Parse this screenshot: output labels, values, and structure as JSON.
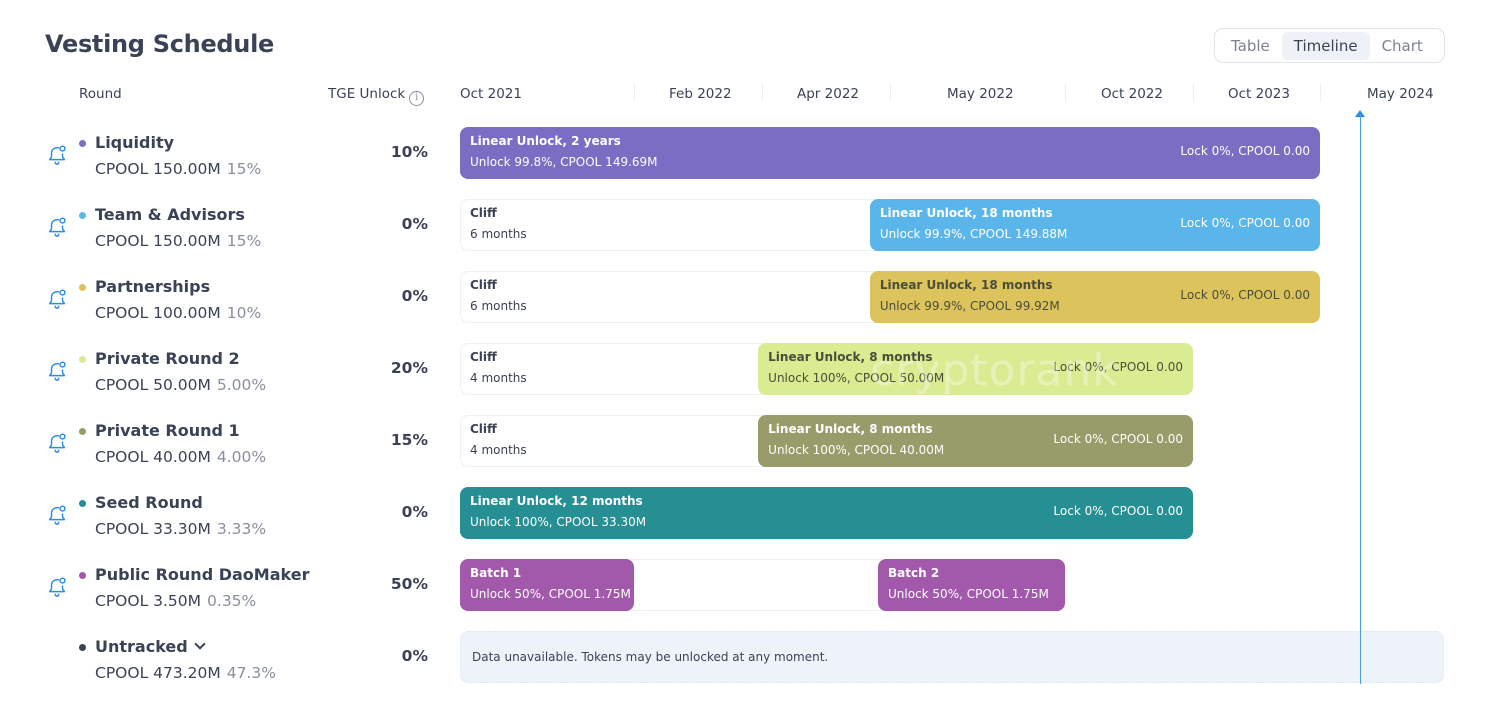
{
  "header": {
    "title": "Vesting Schedule",
    "view_options": [
      {
        "label": "Table",
        "active": false
      },
      {
        "label": "Timeline",
        "active": true
      },
      {
        "label": "Chart",
        "active": false
      }
    ]
  },
  "columns": {
    "round": "Round",
    "tge_unlock": "TGE Unlock",
    "tge_info_icon": "i"
  },
  "timeline": {
    "ticks": [
      "Oct 2021",
      "Feb 2022",
      "Apr 2022",
      "May 2022",
      "Oct 2022",
      "Oct 2023",
      "May 2024"
    ],
    "now_marker": "current-date-marker",
    "watermark": "cryptorank"
  },
  "rounds": [
    {
      "name": "Liquidity",
      "amount": "CPOOL 150.00M",
      "share": "15%",
      "tge": "10%",
      "color": "#7b6cc4",
      "bell": true,
      "segments": [
        {
          "type": "linear",
          "title": "Linear Unlock, 2 years",
          "detail": "Unlock 99.8%, CPOOL 149.69M",
          "lock": "Lock 0%, CPOOL 0.00",
          "color": "#7b6cc4",
          "start": 0,
          "end": 6
        }
      ]
    },
    {
      "name": "Team & Advisors",
      "amount": "CPOOL 150.00M",
      "share": "15%",
      "tge": "0%",
      "color": "#5ab6ea",
      "bell": true,
      "segments": [
        {
          "type": "cliff",
          "title": "Cliff",
          "detail": "6 months",
          "start": 0,
          "end": 2.93
        },
        {
          "type": "linear",
          "title": "Linear Unlock, 18 months",
          "detail": "Unlock 99.9%, CPOOL 149.88M",
          "lock": "Lock 0%, CPOOL 0.00",
          "color": "#5ab6ea",
          "start": 2.93,
          "end": 6
        }
      ]
    },
    {
      "name": "Partnerships",
      "amount": "CPOOL 100.00M",
      "share": "10%",
      "tge": "0%",
      "color": "#dcc35c",
      "bell": true,
      "segments": [
        {
          "type": "cliff",
          "title": "Cliff",
          "detail": "6 months",
          "start": 0,
          "end": 2.93
        },
        {
          "type": "linear",
          "title": "Linear Unlock, 18 months",
          "detail": "Unlock 99.9%, CPOOL 99.92M",
          "lock": "Lock 0%, CPOOL 0.00",
          "color": "#dcc35c",
          "dark": true,
          "start": 2.93,
          "end": 6
        }
      ]
    },
    {
      "name": "Private Round 2",
      "amount": "CPOOL 50.00M",
      "share": "5.00%",
      "tge": "20%",
      "color": "#d9ec92",
      "bell": true,
      "segments": [
        {
          "type": "cliff",
          "title": "Cliff",
          "detail": "4 months",
          "start": 0,
          "end": 1.97
        },
        {
          "type": "linear",
          "title": "Linear Unlock, 8 months",
          "detail": "Unlock 100%, CPOOL 50.00M",
          "lock": "Lock 0%, CPOOL 0.00",
          "color": "#d9ec92",
          "dark": true,
          "start": 1.97,
          "end": 5
        }
      ]
    },
    {
      "name": "Private Round 1",
      "amount": "CPOOL 40.00M",
      "share": "4.00%",
      "tge": "15%",
      "color": "#979c6a",
      "bell": true,
      "segments": [
        {
          "type": "cliff",
          "title": "Cliff",
          "detail": "4 months",
          "start": 0,
          "end": 1.97
        },
        {
          "type": "linear",
          "title": "Linear Unlock, 8 months",
          "detail": "Unlock 100%, CPOOL 40.00M",
          "lock": "Lock 0%, CPOOL 0.00",
          "color": "#979c6a",
          "start": 1.97,
          "end": 5
        }
      ]
    },
    {
      "name": "Seed Round",
      "amount": "CPOOL 33.30M",
      "share": "3.33%",
      "tge": "0%",
      "color": "#268f93",
      "bell": true,
      "segments": [
        {
          "type": "linear",
          "title": "Linear Unlock, 12 months",
          "detail": "Unlock 100%, CPOOL 33.30M",
          "lock": "Lock 0%, CPOOL 0.00",
          "color": "#268f93",
          "start": 0,
          "end": 5
        }
      ]
    },
    {
      "name": "Public Round DaoMaker",
      "amount": "CPOOL 3.50M",
      "share": "0.35%",
      "tge": "50%",
      "color": "#a259ab",
      "bell": true,
      "track_end": 4,
      "segments": [
        {
          "type": "batch",
          "title": "Batch 1",
          "detail": "Unlock 50%, CPOOL 1.75M",
          "color": "#a259ab",
          "start": 0,
          "end": 1
        },
        {
          "type": "batch",
          "title": "Batch 2",
          "detail": "Unlock 50%, CPOOL 1.75M",
          "color": "#a259ab",
          "start": 3,
          "end": 4
        }
      ]
    },
    {
      "name": "Untracked",
      "amount": "CPOOL 473.20M",
      "share": "47.3%",
      "tge": "0%",
      "color": "#3b4256",
      "bell": false,
      "expandable": true,
      "segments": [
        {
          "type": "unavailable",
          "title": "Data unavailable. Tokens may be unlocked at any moment.",
          "start": 0,
          "end": 7
        }
      ]
    }
  ]
}
